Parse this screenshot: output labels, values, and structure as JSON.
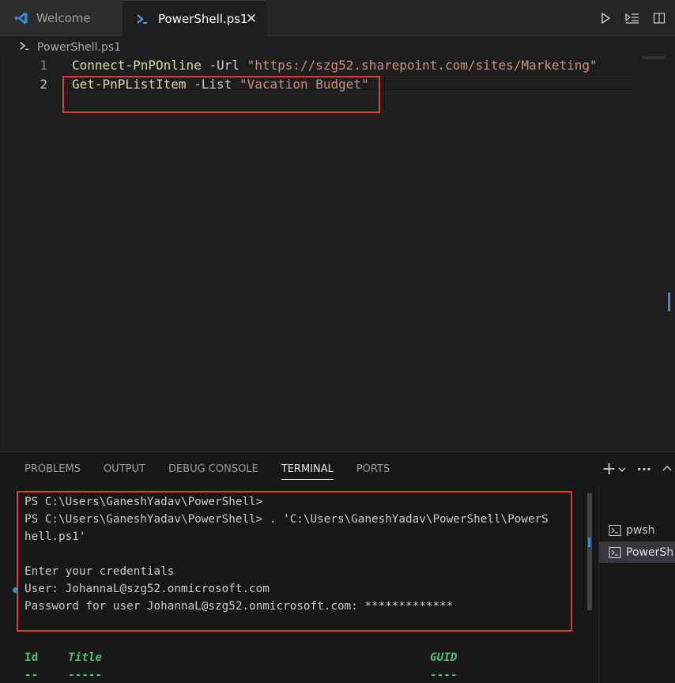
{
  "tabs": [
    {
      "label": "Welcome",
      "icon": "vscode-logo-icon"
    },
    {
      "label": "PowerShell.ps1",
      "icon": "powershell-icon",
      "close": "✕"
    }
  ],
  "breadcrumb": {
    "file": "PowerShell.ps1"
  },
  "editor": {
    "lines": [
      {
        "number": "1",
        "cmd": "Connect-PnPOnline",
        "param": " -Url ",
        "str": "\"https://szg52.sharepoint.com/sites/Marketing\""
      },
      {
        "number": "2",
        "cmd": "Get-PnPListItem",
        "param": " -List ",
        "str": "\"Vacation Budget\""
      }
    ]
  },
  "panel": {
    "tabs": [
      "PROBLEMS",
      "OUTPUT",
      "DEBUG CONSOLE",
      "TERMINAL",
      "PORTS"
    ],
    "active_tab": "TERMINAL",
    "terminal_lines": [
      "PS C:\\Users\\GaneshYadav\\PowerShell>",
      "PS C:\\Users\\GaneshYadav\\PowerShell> . 'C:\\Users\\GaneshYadav\\PowerShell\\PowerS",
      "hell.ps1'",
      "",
      "Enter your credentials",
      "User: JohannaL@szg52.onmicrosoft.com",
      "Password for user JohannaL@szg52.onmicrosoft.com: *************"
    ],
    "output_headers": {
      "id": "Id",
      "title": "Title",
      "guid": "GUID"
    },
    "output_underlines": {
      "id": "--",
      "title": "-----",
      "guid": "----"
    },
    "terminal_list": [
      {
        "label": "pwsh",
        "selected": false
      },
      {
        "label": "PowerSh",
        "selected": true
      }
    ],
    "actions": {
      "add": "+",
      "more": "···"
    }
  },
  "colors": {
    "accent": "#3a8ed0",
    "highlight": "#e0393e",
    "header_green": "#4ec26c"
  }
}
